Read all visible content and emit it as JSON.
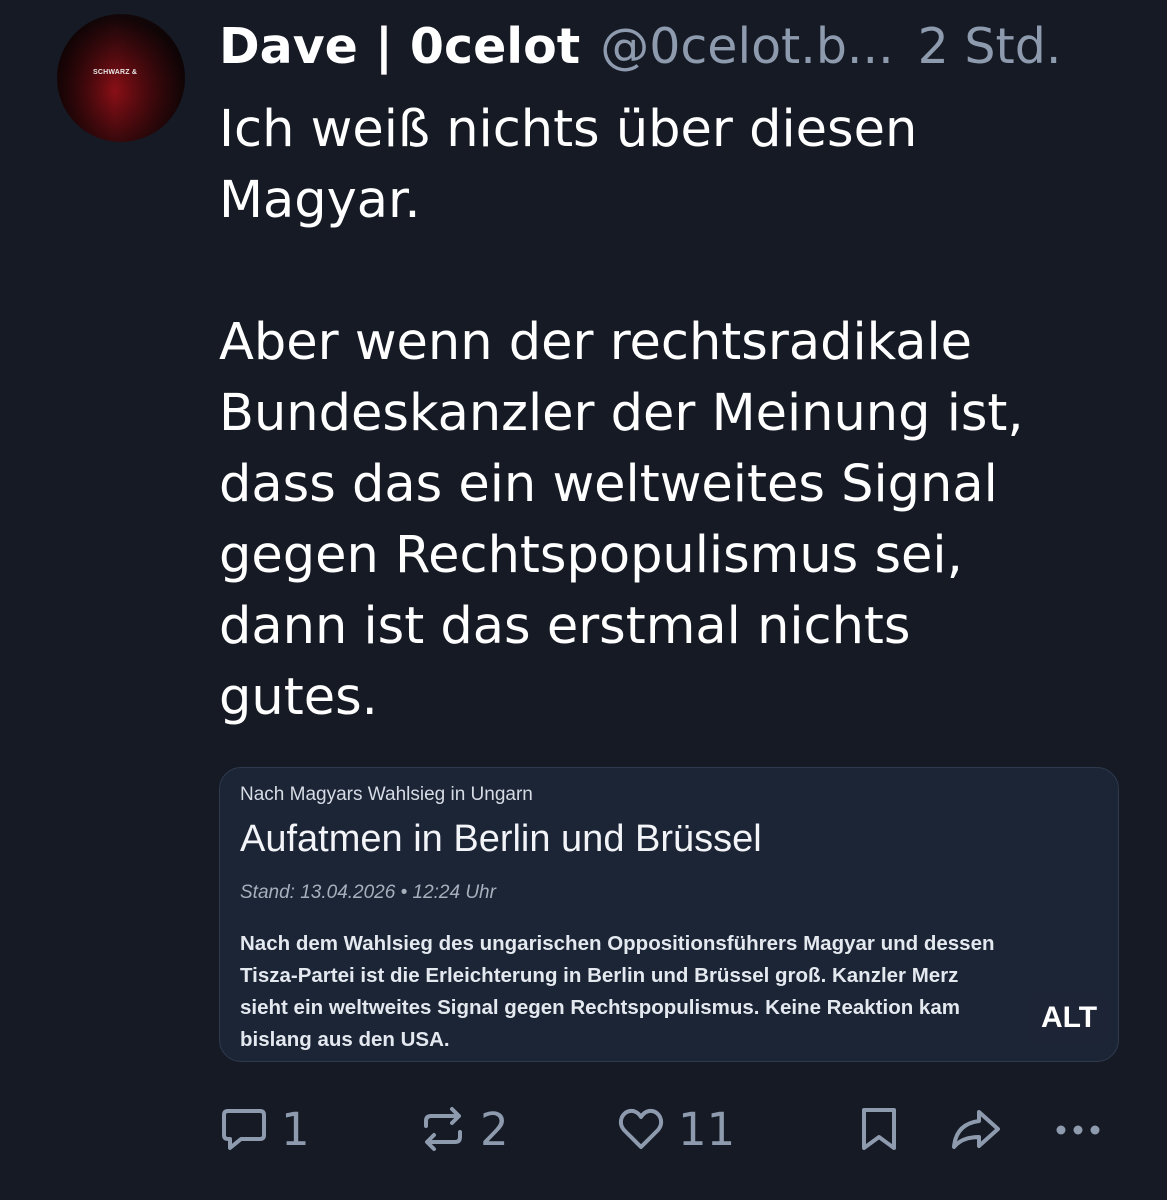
{
  "post": {
    "author": {
      "display_name": "Dave | 0celot",
      "handle": "@0celot.b...",
      "avatar_text": "SCHWARZ &"
    },
    "time": "2 Std.",
    "text_lines": [
      "Ich weiß nichts über diesen",
      "Magyar.",
      "",
      "Aber wenn der rechtsradikale",
      "Bundeskanzler der Meinung ist,",
      "dass das ein weltweites Signal",
      "gegen Rechtspopulismus sei,",
      "dann ist das erstmal nichts",
      "gutes."
    ]
  },
  "embed": {
    "kicker": "Nach Magyars Wahlsieg in Ungarn",
    "headline": "Aufatmen in Berlin und Brüssel",
    "stand": "Stand: 13.04.2026 • 12:24 Uhr",
    "body_lines": [
      "Nach dem Wahlsieg des ungarischen Oppositionsführers Magyar und dessen",
      "Tisza-Partei ist die Erleichterung in Berlin und Brüssel groß. Kanzler Merz",
      "sieht ein weltweites Signal gegen Rechtspopulismus. Keine Reaktion kam",
      "bislang aus den USA."
    ],
    "alt_label": "ALT"
  },
  "actions": {
    "reply_count": "1",
    "repost_count": "2",
    "like_count": "11",
    "icons": [
      "reply-icon",
      "repost-icon",
      "like-icon",
      "bookmark-icon",
      "share-icon",
      "more-icon"
    ]
  },
  "colors": {
    "background": "#151a24",
    "muted_text": "#8e9aae",
    "card_background": "#1c2536"
  }
}
